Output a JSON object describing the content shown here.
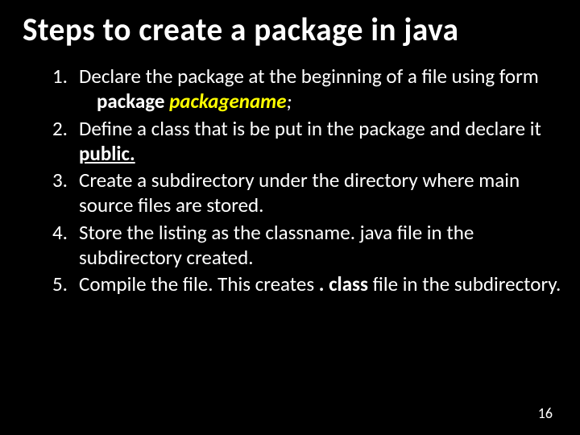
{
  "title": "Steps to create a package in java",
  "items": [
    {
      "n": "1.",
      "text_a": "Declare the package at the beginning of a file using form",
      "code_kw": "package",
      "code_name": "packagename",
      "code_semi": ";"
    },
    {
      "n": "2.",
      "text_a": "Define a class that is be put in the package and declare it ",
      "ul": "public."
    },
    {
      "n": "3.",
      "text_a": "Create a subdirectory under the directory where main source files are stored."
    },
    {
      "n": "4.",
      "text_a": "Store the listing as the classname. java file in the subdirectory created."
    },
    {
      "n": "5.",
      "text_a": "Compile the file. This creates ",
      "bold_mid": ". class",
      "text_b": " file in the subdirectory."
    }
  ],
  "page_number": "16"
}
